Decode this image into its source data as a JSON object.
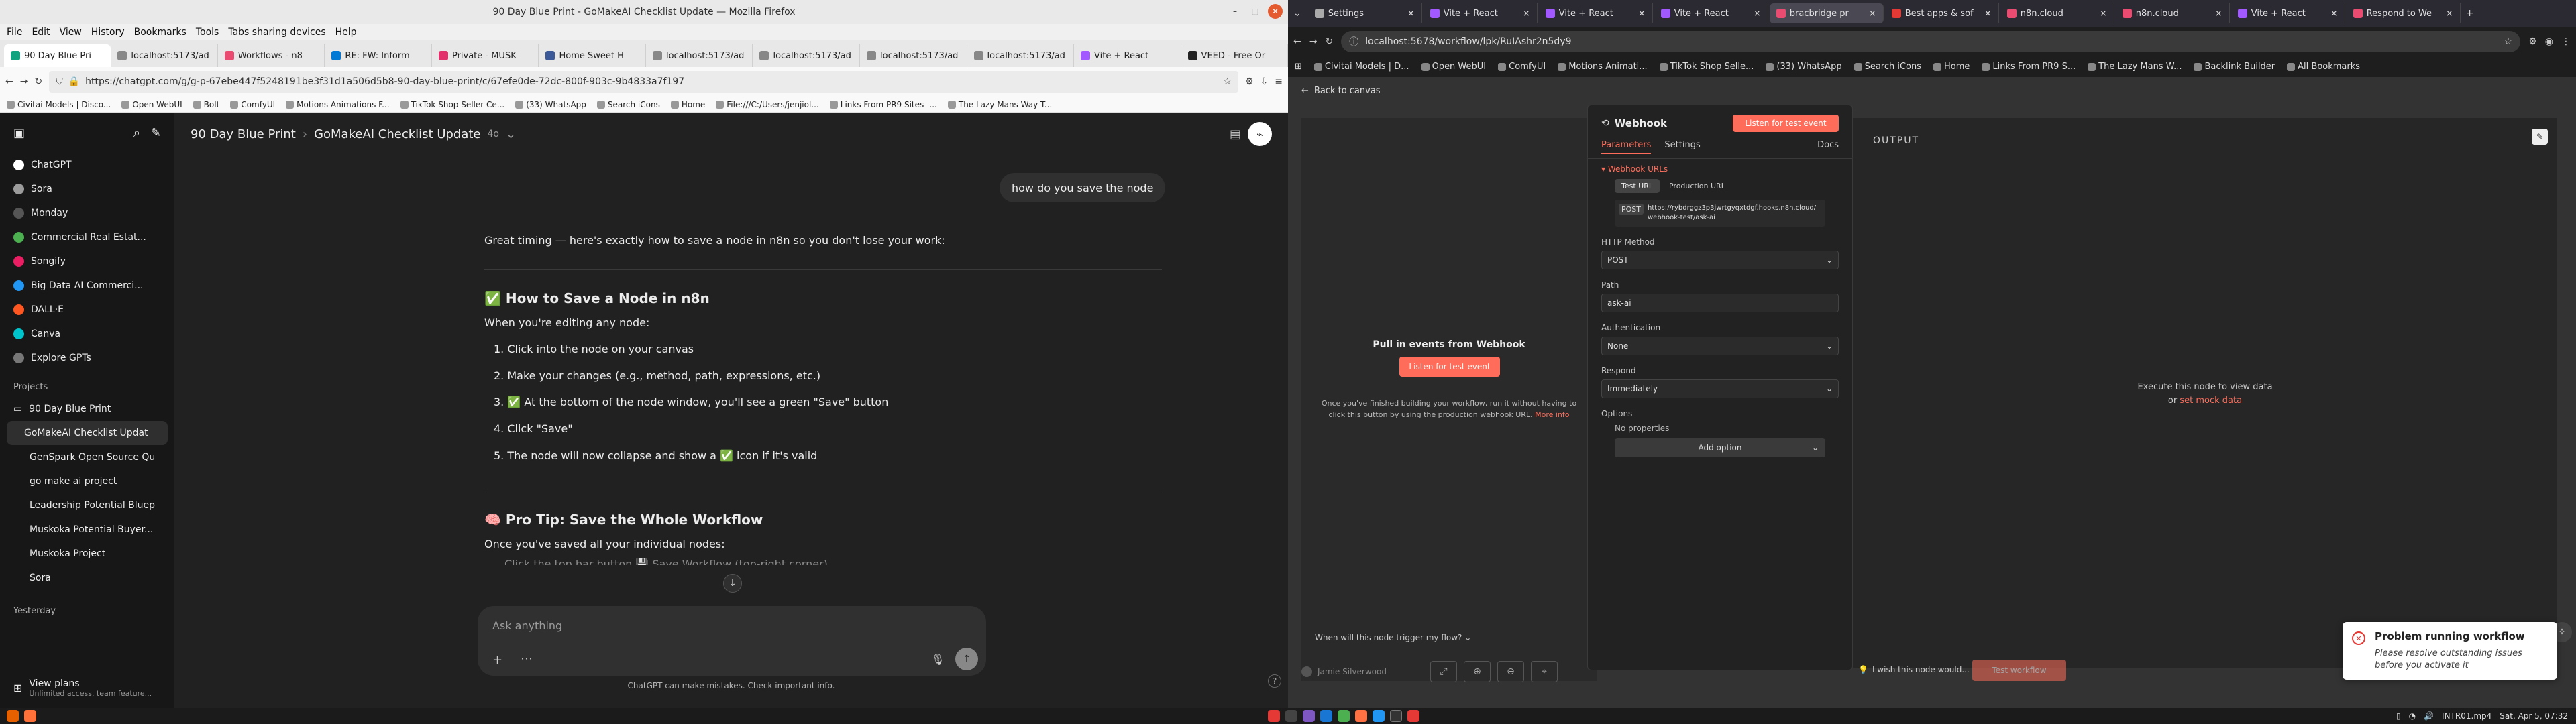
{
  "left_window": {
    "title": "90 Day Blue Print - GoMakeAI Checklist Update — Mozilla Firefox",
    "menu": [
      "File",
      "Edit",
      "View",
      "History",
      "Bookmarks",
      "Tools",
      "Tabs sharing devices",
      "Help"
    ],
    "tabs": [
      {
        "label": "90 Day Blue Pri",
        "color": "#10a37f",
        "active": true
      },
      {
        "label": "localhost:5173/ad",
        "color": "#888888"
      },
      {
        "label": "Workflows - n8",
        "color": "#ea4b71"
      },
      {
        "label": "RE: FW: Inform",
        "color": "#0078d4"
      },
      {
        "label": "Private - MUSK",
        "color": "#e1306c"
      },
      {
        "label": "Home Sweet H",
        "color": "#3b5998"
      },
      {
        "label": "localhost:5173/ad",
        "color": "#888888"
      },
      {
        "label": "localhost:5173/ad",
        "color": "#888888"
      },
      {
        "label": "localhost:5173/ad",
        "color": "#888888"
      },
      {
        "label": "localhost:5173/ad",
        "color": "#888888"
      },
      {
        "label": "Vite + React",
        "color": "#a259ff"
      },
      {
        "label": "VEED - Free Or",
        "color": "#222222"
      }
    ],
    "url": "https://chatgpt.com/g/g-p-67ebe447f5248191be3f31d1a506d5b8-90-day-blue-print/c/67efe0de-72dc-800f-903c-9b4833a7f197",
    "bookmarks": [
      "Civitai Models | Disco...",
      "Open WebUI",
      "Bolt",
      "ComfyUI",
      "Motions Animations F...",
      "TikTok Shop Seller Ce...",
      "(33) WhatsApp",
      "Search iCons",
      "Home",
      "File:///C:/Users/jenjiol...",
      "Links From PR9 Sites -...",
      "The Lazy Mans Way T..."
    ]
  },
  "chatgpt": {
    "breadcrumb_project": "90 Day Blue Print",
    "breadcrumb_chat": "GoMakeAI Checklist Update",
    "model": "4o",
    "sidebar": {
      "gpts": [
        {
          "label": "ChatGPT",
          "color": "#ffffff"
        },
        {
          "label": "Sora",
          "color": "#9b9b9b"
        },
        {
          "label": "Monday",
          "color": "#555555"
        },
        {
          "label": "Commercial Real Estat...",
          "color": "#4caf50"
        },
        {
          "label": "Songify",
          "color": "#e91e63"
        },
        {
          "label": "Big Data AI Commerci...",
          "color": "#2196f3"
        },
        {
          "label": "DALL·E",
          "color": "#ff5722"
        },
        {
          "label": "Canva",
          "color": "#00c4cc"
        },
        {
          "label": "Explore GPTs",
          "color": "#777777"
        }
      ],
      "projects_label": "Projects",
      "projects": [
        {
          "label": "90 Day Blue Print",
          "active": false
        },
        {
          "label": "GoMakeAI Checklist Updat",
          "active": true
        },
        {
          "label": "GenSpark Open Source Qu",
          "active": false
        },
        {
          "label": "go make ai project",
          "active": false
        },
        {
          "label": "Leadership Potential Bluep",
          "active": false
        },
        {
          "label": "Muskoka Potential Buyer...",
          "active": false
        },
        {
          "label": "Muskoka Project",
          "active": false
        },
        {
          "label": "Sora",
          "active": false
        }
      ],
      "yesterday_label": "Yesterday",
      "view_plans": "View plans",
      "view_plans_sub": "Unlimited access, team feature..."
    },
    "user_message": "how do you save the node",
    "intro": "Great timing — here's exactly how to save a node in n8n so you don't lose your work:",
    "h1": "✅ How to Save a Node in n8n",
    "when_editing": "When you're editing any node:",
    "steps": [
      "1. Click into the node on your canvas",
      "2. Make your changes (e.g., method, path, expressions, etc.)",
      "3. ✅ At the bottom of the node window, you'll see a green \"Save\" button",
      "4. Click \"Save\"",
      "5. The node will now collapse and show a ✅ icon if it's valid"
    ],
    "h2": "🧠 Pro Tip: Save the Whole Workflow",
    "once_saved": "Once you've saved all your individual nodes:",
    "cut_line": "Click the top bar button 💾 Save Workflow (top-right corner)",
    "input_placeholder": "Ask anything",
    "disclaimer": "ChatGPT can make mistakes. Check important info."
  },
  "right_window": {
    "tabs": [
      {
        "label": "Settings",
        "color": "#aaaaaa"
      },
      {
        "label": "Vite + React",
        "color": "#a259ff"
      },
      {
        "label": "Vite + React",
        "color": "#a259ff"
      },
      {
        "label": "Vite + React",
        "color": "#a259ff"
      },
      {
        "label": "bracbridge pr",
        "color": "#ea4b71",
        "active": true
      },
      {
        "label": "Best apps & sof",
        "color": "#e53935"
      },
      {
        "label": "n8n.cloud",
        "color": "#ea4b71"
      },
      {
        "label": "n8n.cloud",
        "color": "#ea4b71"
      },
      {
        "label": "Vite + React",
        "color": "#a259ff"
      },
      {
        "label": "Respond to We",
        "color": "#ea4b71"
      }
    ],
    "url": "localhost:5678/workflow/lpk/RuIAshr2n5dy9",
    "bookmarks": [
      "Civitai Models | D...",
      "Open WebUI",
      "ComfyUI",
      "Motions Animati...",
      "TikTok Shop Selle...",
      "(33) WhatsApp",
      "Search iCons",
      "Home",
      "Links From PR9 S...",
      "The Lazy Mans W...",
      "Backlink Builder",
      "All Bookmarks"
    ]
  },
  "n8n": {
    "back_to_canvas": "Back to canvas",
    "left": {
      "title": "Pull in events from Webhook",
      "listen_btn": "Listen for test event",
      "desc": "Once you've finished building your workflow, run it without having to click this button by using the production webhook URL.",
      "more_info": "More info",
      "trigger_q": "When will this node trigger my flow?"
    },
    "node": {
      "name": "Webhook",
      "listen_btn": "Listen for test event",
      "tab_params": "Parameters",
      "tab_settings": "Settings",
      "docs": "Docs",
      "webhook_urls": "Webhook URLs",
      "test_url": "Test URL",
      "prod_url": "Production URL",
      "method_chip": "POST",
      "url_value": "https://rybdrggz3p3jwrtgyqxtdgf.hooks.n8n.cloud/webhook-test/ask-ai",
      "http_method_label": "HTTP Method",
      "http_method": "POST",
      "path_label": "Path",
      "path": "ask-ai",
      "auth_label": "Authentication",
      "auth": "None",
      "respond_label": "Respond",
      "respond": "Immediately",
      "options_label": "Options",
      "no_props": "No properties",
      "add_option": "Add option",
      "wish": "I wish this node would..."
    },
    "output": {
      "label": "OUTPUT",
      "exec_text": "Execute this node to view data",
      "or": "or",
      "mock": "set mock data"
    },
    "bottom_user": "Jamie Silverwood",
    "test_workflow": "Test workflow",
    "toast_title": "Problem running workflow",
    "toast_body": "Please resolve outstanding issues before you activate it"
  },
  "taskbar": {
    "file": "INTR01.mp4",
    "datetime": "Sat, Apr 5, 07:32"
  }
}
